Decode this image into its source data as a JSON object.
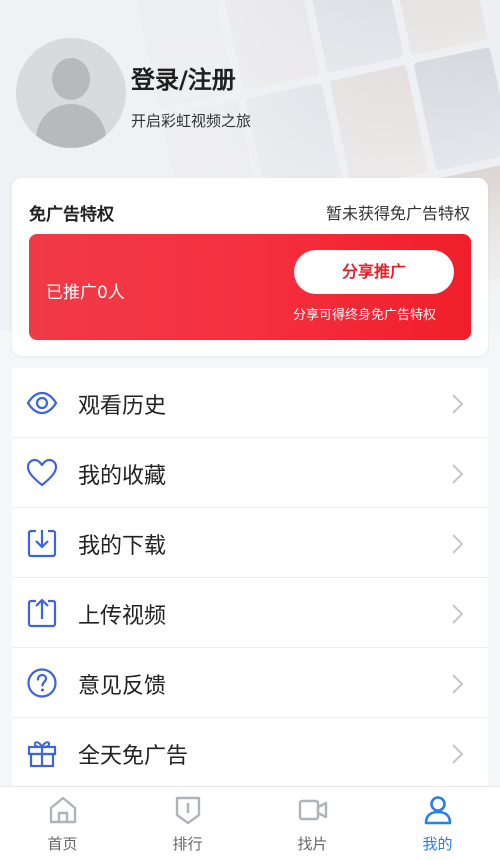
{
  "profile": {
    "title": "登录/注册",
    "subtitle": "开启彩虹视频之旅"
  },
  "adfree": {
    "title": "免广告特权",
    "status": "暂未获得免广告特权",
    "promoted": "已推广0人",
    "share_button": "分享推广",
    "share_note": "分享可得终身免广告特权"
  },
  "menu": {
    "items": [
      {
        "label": "观看历史",
        "icon": "eye-icon"
      },
      {
        "label": "我的收藏",
        "icon": "heart-icon"
      },
      {
        "label": "我的下载",
        "icon": "download-icon"
      },
      {
        "label": "上传视频",
        "icon": "upload-icon"
      },
      {
        "label": "意见反馈",
        "icon": "question-icon"
      },
      {
        "label": "全天免广告",
        "icon": "gift-icon"
      }
    ]
  },
  "tabbar": {
    "tabs": [
      {
        "label": "首页",
        "icon": "home-icon"
      },
      {
        "label": "排行",
        "icon": "rank-icon"
      },
      {
        "label": "找片",
        "icon": "video-camera-icon"
      },
      {
        "label": "我的",
        "icon": "user-icon",
        "active": true
      }
    ]
  },
  "colors": {
    "accent_red": "#f0303f",
    "accent_blue": "#2a7ef0",
    "icon_blue": "#3d64d8"
  }
}
